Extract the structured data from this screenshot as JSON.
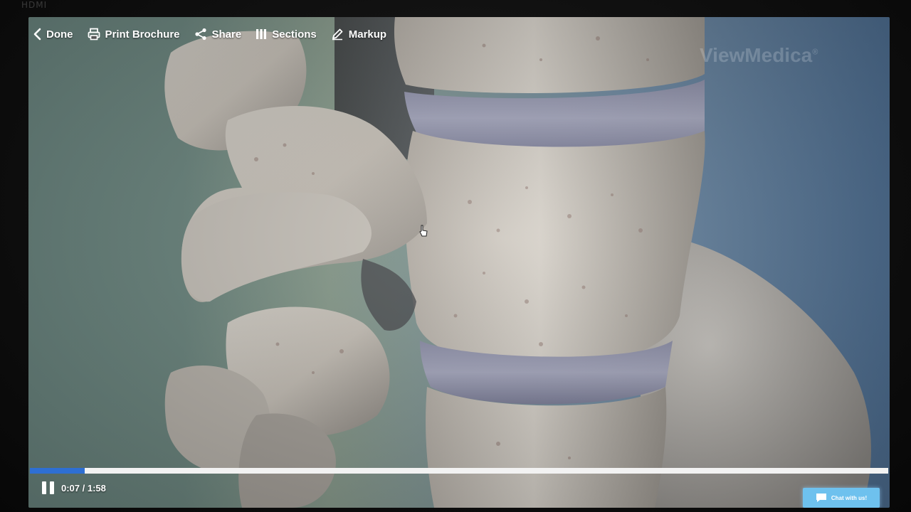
{
  "overlay": {
    "hdmi_label": "HDMI"
  },
  "toolbar": {
    "done_label": "Done",
    "print_label": "Print Brochure",
    "share_label": "Share",
    "sections_label": "Sections",
    "markup_label": "Markup"
  },
  "watermark": {
    "text": "ViewMedica",
    "mark": "®"
  },
  "player": {
    "elapsed": "0:07",
    "duration": "1:58",
    "time_display": "0:07 / 1:58",
    "progress_fraction": 0.064,
    "progress_color": "#2e6fd3"
  },
  "chat": {
    "label": "Chat with us!",
    "color": "#6ec1ee"
  },
  "icons": {
    "done": "chevron-left-icon",
    "print": "printer-icon",
    "share": "share-icon",
    "sections": "sections-bars-icon",
    "markup": "pencil-icon",
    "pause": "pause-icon",
    "chat": "chat-bubble-icon"
  }
}
